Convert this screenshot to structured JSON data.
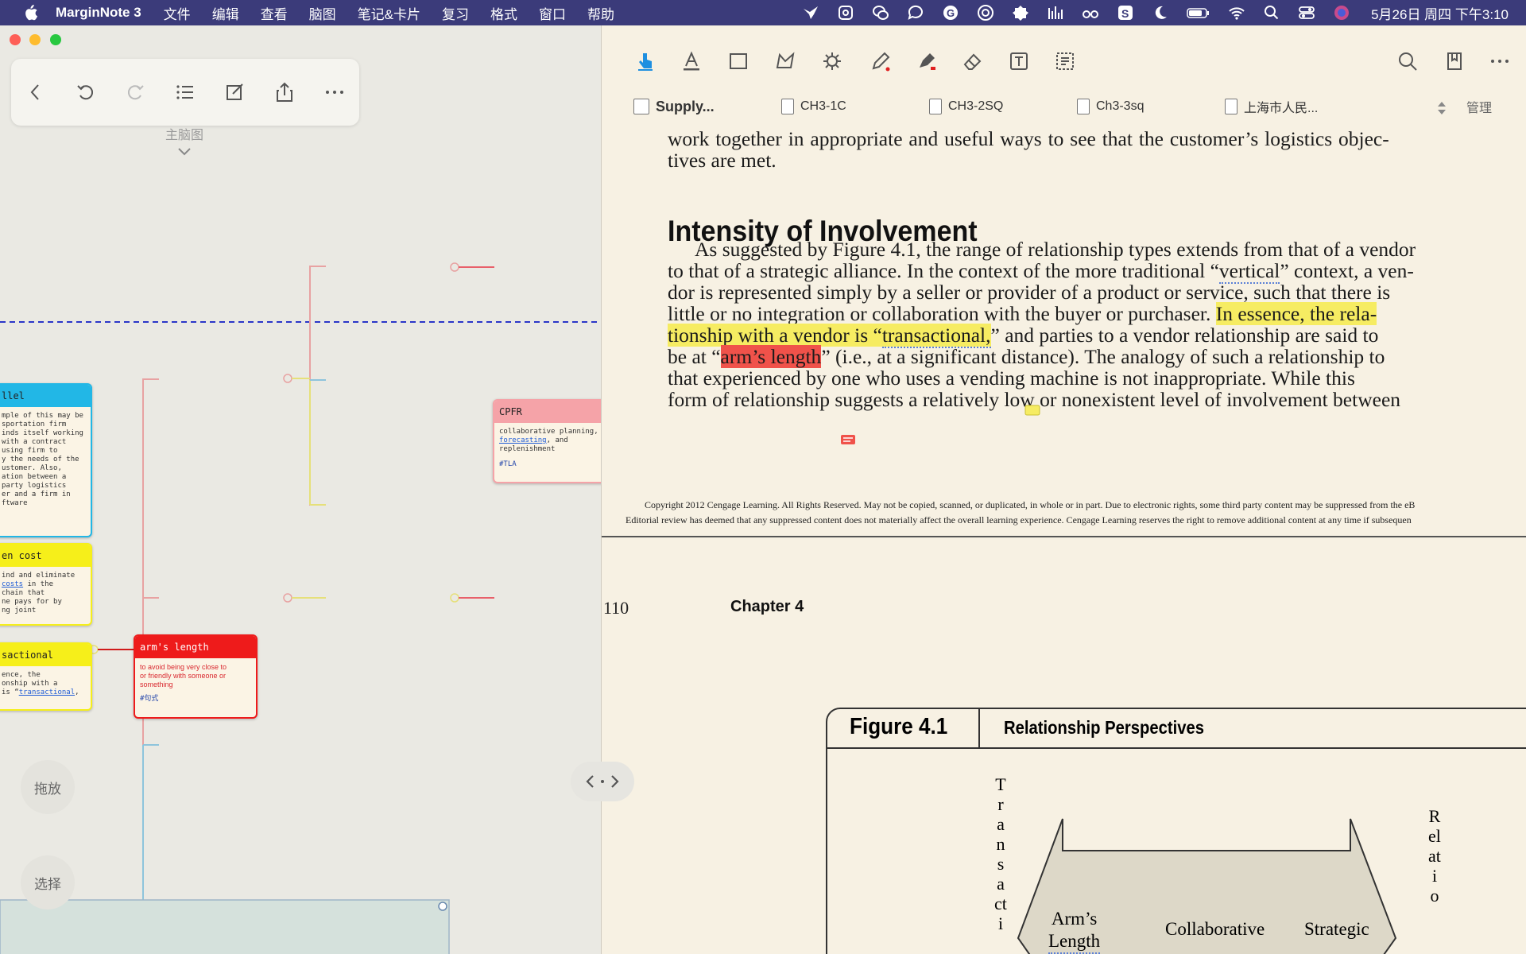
{
  "menubar": {
    "app_name": "MarginNote 3",
    "items": [
      "文件",
      "编辑",
      "查看",
      "脑图",
      "笔记&卡片",
      "复习",
      "格式",
      "窗口",
      "帮助"
    ],
    "clock": "5月26日 周四 下午3:10"
  },
  "mindmap": {
    "title": "主脑图",
    "side_buttons": {
      "drag": "拖放",
      "select": "选择"
    },
    "nodes": {
      "parallel": {
        "title": "llel",
        "body": "mple of this may be\nsportation firm\ninds itself working\nwith a contract\nusing firm to\ny the needs of the\nustomer. Also,\nation between a\nparty logistics\ner and a firm in\nftware"
      },
      "hidden_cost": {
        "title": "en cost",
        "body_1": "ind and eliminate",
        "body_link": "costs",
        "body_2": " in the\n chain that\nne pays for by\nng joint"
      },
      "transactional": {
        "title": "sactional",
        "body_1": "ence, the\nonship with a\n is “",
        "body_link": "transactional",
        "body_2": ","
      },
      "arms_length": {
        "title": "arm's length",
        "body": "to avoid being very close to\nor friendly with someone or\nsomething",
        "tag": "#句式"
      },
      "cpfr": {
        "title": "CPFR",
        "body_1": "collaborative planning,",
        "body_link": "forecasting",
        "body_2": ", and\nreplenishment",
        "tag": "#TLA"
      }
    }
  },
  "document": {
    "tabs": [
      "Supply...",
      "CH3-1C",
      "CH3-2SQ",
      "Ch3-3sq",
      "上海市人民..."
    ],
    "manage": "管理",
    "lines": {
      "l1": "work together in appropriate and useful ways to see that the customer’s logistics objec-",
      "l2": "tives are met.",
      "l4a": "As suggested by Figure 4.1, the range of relationship types extends from that of a vendor",
      "l5a": "to that of a strategic alliance. In the context of the more traditional “",
      "l5b": "vertical",
      "l5c": "” context, a ven-",
      "l6": "dor is represented simply by a seller or provider of a product or service, such that there is",
      "l7a": "little or no integration or collaboration with the buyer or purchaser. ",
      "l7b": "In essence, the rela-",
      "l8a": "tionship with a vendor is “",
      "l8b": "transactional,",
      "l8c": "” and parties to a vendor relationship are said to",
      "l9a": "be at “",
      "l9b": "arm’s length",
      "l9c": "” (i.e., at a significant distance). The analogy of such a relationship to",
      "l10": "that experienced by one who uses a vending machine is not inappropriate. While this",
      "l11": "form of relationship suggests a relatively low or nonexistent level of involvement between"
    },
    "heading": "Intensity of Involvement",
    "footer_1": "Copyright 2012 Cengage Learning. All Rights Reserved. May not be copied, scanned, or duplicated, in whole or in part. Due to electronic rights, some third party content may be suppressed from the eB",
    "footer_2": "Editorial review has deemed that any suppressed content does not materially affect the overall learning experience. Cengage Learning reserves the right to remove additional content at any time if subsequen",
    "page_number": "110",
    "chapter": "Chapter 4",
    "figure": {
      "number": "Figure 4.1",
      "title": "Relationship Perspectives",
      "left_vertical": "Transacti",
      "right_vertical": "Relatio",
      "arrow_left_1": "Arm’s",
      "arrow_left_2": "Length",
      "arrow_mid": "Collaborative",
      "arrow_right": "Strategic"
    }
  },
  "colors": {
    "menubar": "#3b3b7a",
    "highlight_yellow": "#f6ec62",
    "highlight_red": "#f0524a",
    "node_blue": "#22b7e6",
    "node_yellow": "#f6ef1a",
    "node_red": "#ee1b1b",
    "node_pink": "#f5a3a8"
  }
}
